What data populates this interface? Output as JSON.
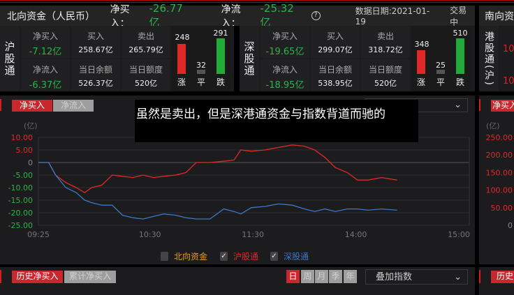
{
  "header": {
    "title": "北向资金（人民币）",
    "net_buy_label": "净买入：",
    "net_buy_value": "-26.77亿",
    "net_flow_label": "净流入：",
    "net_flow_value": "-25.32亿",
    "help_icon": "?",
    "date_text": "数据日期:2021-01-19",
    "status": "交易中",
    "south_title": "南向资"
  },
  "sh": {
    "label": "沪股通",
    "net_buy_label": "净买入",
    "net_buy": "-7.12亿",
    "buy_label": "买入",
    "buy": "258.67亿",
    "sell_label": "卖出",
    "sell": "265.79亿",
    "net_flow_label": "净流入",
    "net_flow": "-6.37亿",
    "balance_label": "当日余额",
    "balance": "526.37亿",
    "quota_label": "当日额度",
    "quota": "520亿",
    "up": "248",
    "flat": "32",
    "down": "291",
    "up_label": "涨",
    "flat_label": "平",
    "down_label": "跌"
  },
  "sz": {
    "label": "深股通",
    "net_buy_label": "净买入",
    "net_buy": "-19.65亿",
    "buy_label": "买入",
    "buy": "299.07亿",
    "sell_label": "卖出",
    "sell": "318.72亿",
    "net_flow_label": "净流入",
    "net_flow": "-18.95亿",
    "balance_label": "当日余额",
    "balance": "538.95亿",
    "quota_label": "当日额度",
    "quota": "520亿",
    "up": "348",
    "flat": "25",
    "down": "510",
    "up_label": "涨",
    "flat_label": "平",
    "down_label": "跌"
  },
  "south": {
    "label": "港股通(沪)",
    "v1": "10",
    "v2": "10"
  },
  "tabs": {
    "net_buy": "净买入",
    "net_flow": "净流入"
  },
  "overlay": "虽然是卖出，但是深港通资金与指数背道而驰的",
  "chart_data": {
    "type": "line",
    "unit": "(亿)",
    "ylim": [
      -25,
      10
    ],
    "yticks": [
      "10.00",
      "5.00",
      "0",
      "-5.00",
      "-10.00",
      "-15.00",
      "-20.00",
      "-25.00"
    ],
    "ytick_values": [
      10,
      5,
      0,
      -5,
      -10,
      -15,
      -20,
      -25
    ],
    "xticks": [
      "09:25",
      "10:30",
      "11:30",
      "14:00",
      "15:00"
    ],
    "xtick_minutes": [
      0,
      65,
      125,
      185,
      245
    ],
    "x_minutes": [
      0,
      6,
      10,
      16,
      22,
      27,
      31,
      37,
      43,
      49,
      55,
      61,
      67,
      73,
      80,
      86,
      92,
      100,
      108,
      114,
      118,
      124,
      132,
      140,
      148,
      155,
      161,
      167,
      173,
      180,
      186,
      192,
      200,
      209
    ],
    "series": [
      {
        "name": "沪股通",
        "color": "#e02828",
        "values": [
          0,
          0,
          -5,
          -8,
          -10,
          -12,
          -10,
          -9,
          -5,
          -5.5,
          -6,
          -5,
          -6,
          -5.5,
          -5,
          -4,
          0,
          0,
          0.5,
          1,
          5,
          4.5,
          5,
          6,
          7,
          6.5,
          5,
          2,
          -2,
          -4,
          -7,
          -7,
          -6,
          -7
        ]
      },
      {
        "name": "深股通",
        "color": "#3a78c8",
        "values": [
          0,
          0,
          -5,
          -10,
          -12,
          -15,
          -16,
          -17,
          -17,
          -21,
          -22,
          -22.5,
          -21.5,
          -20.5,
          -21,
          -22,
          -22.5,
          -22.5,
          -18.5,
          -19.5,
          -20.5,
          -18,
          -17.5,
          -16.5,
          -17,
          -18.5,
          -19.5,
          -18.5,
          -19.5,
          -18.5,
          -18.5,
          -19,
          -18.5,
          -19
        ]
      }
    ],
    "legend": [
      {
        "label": "北向资金",
        "color": "#e0a020",
        "checked": false
      },
      {
        "label": "沪股通",
        "color": "#e02828",
        "checked": true
      },
      {
        "label": "深股通",
        "color": "#3a78c8",
        "checked": true
      }
    ],
    "right_yticks": [
      "250.00",
      "200.00",
      "150.00",
      "100.00",
      "50.00",
      "0"
    ]
  },
  "bottom": {
    "hist_net_buy": "历史净买入",
    "cum_net_buy": "累计净买入",
    "periods": [
      "日",
      "周",
      "月",
      "季",
      "年"
    ],
    "overlay_index": "叠加指数",
    "hist_short": "历史"
  }
}
